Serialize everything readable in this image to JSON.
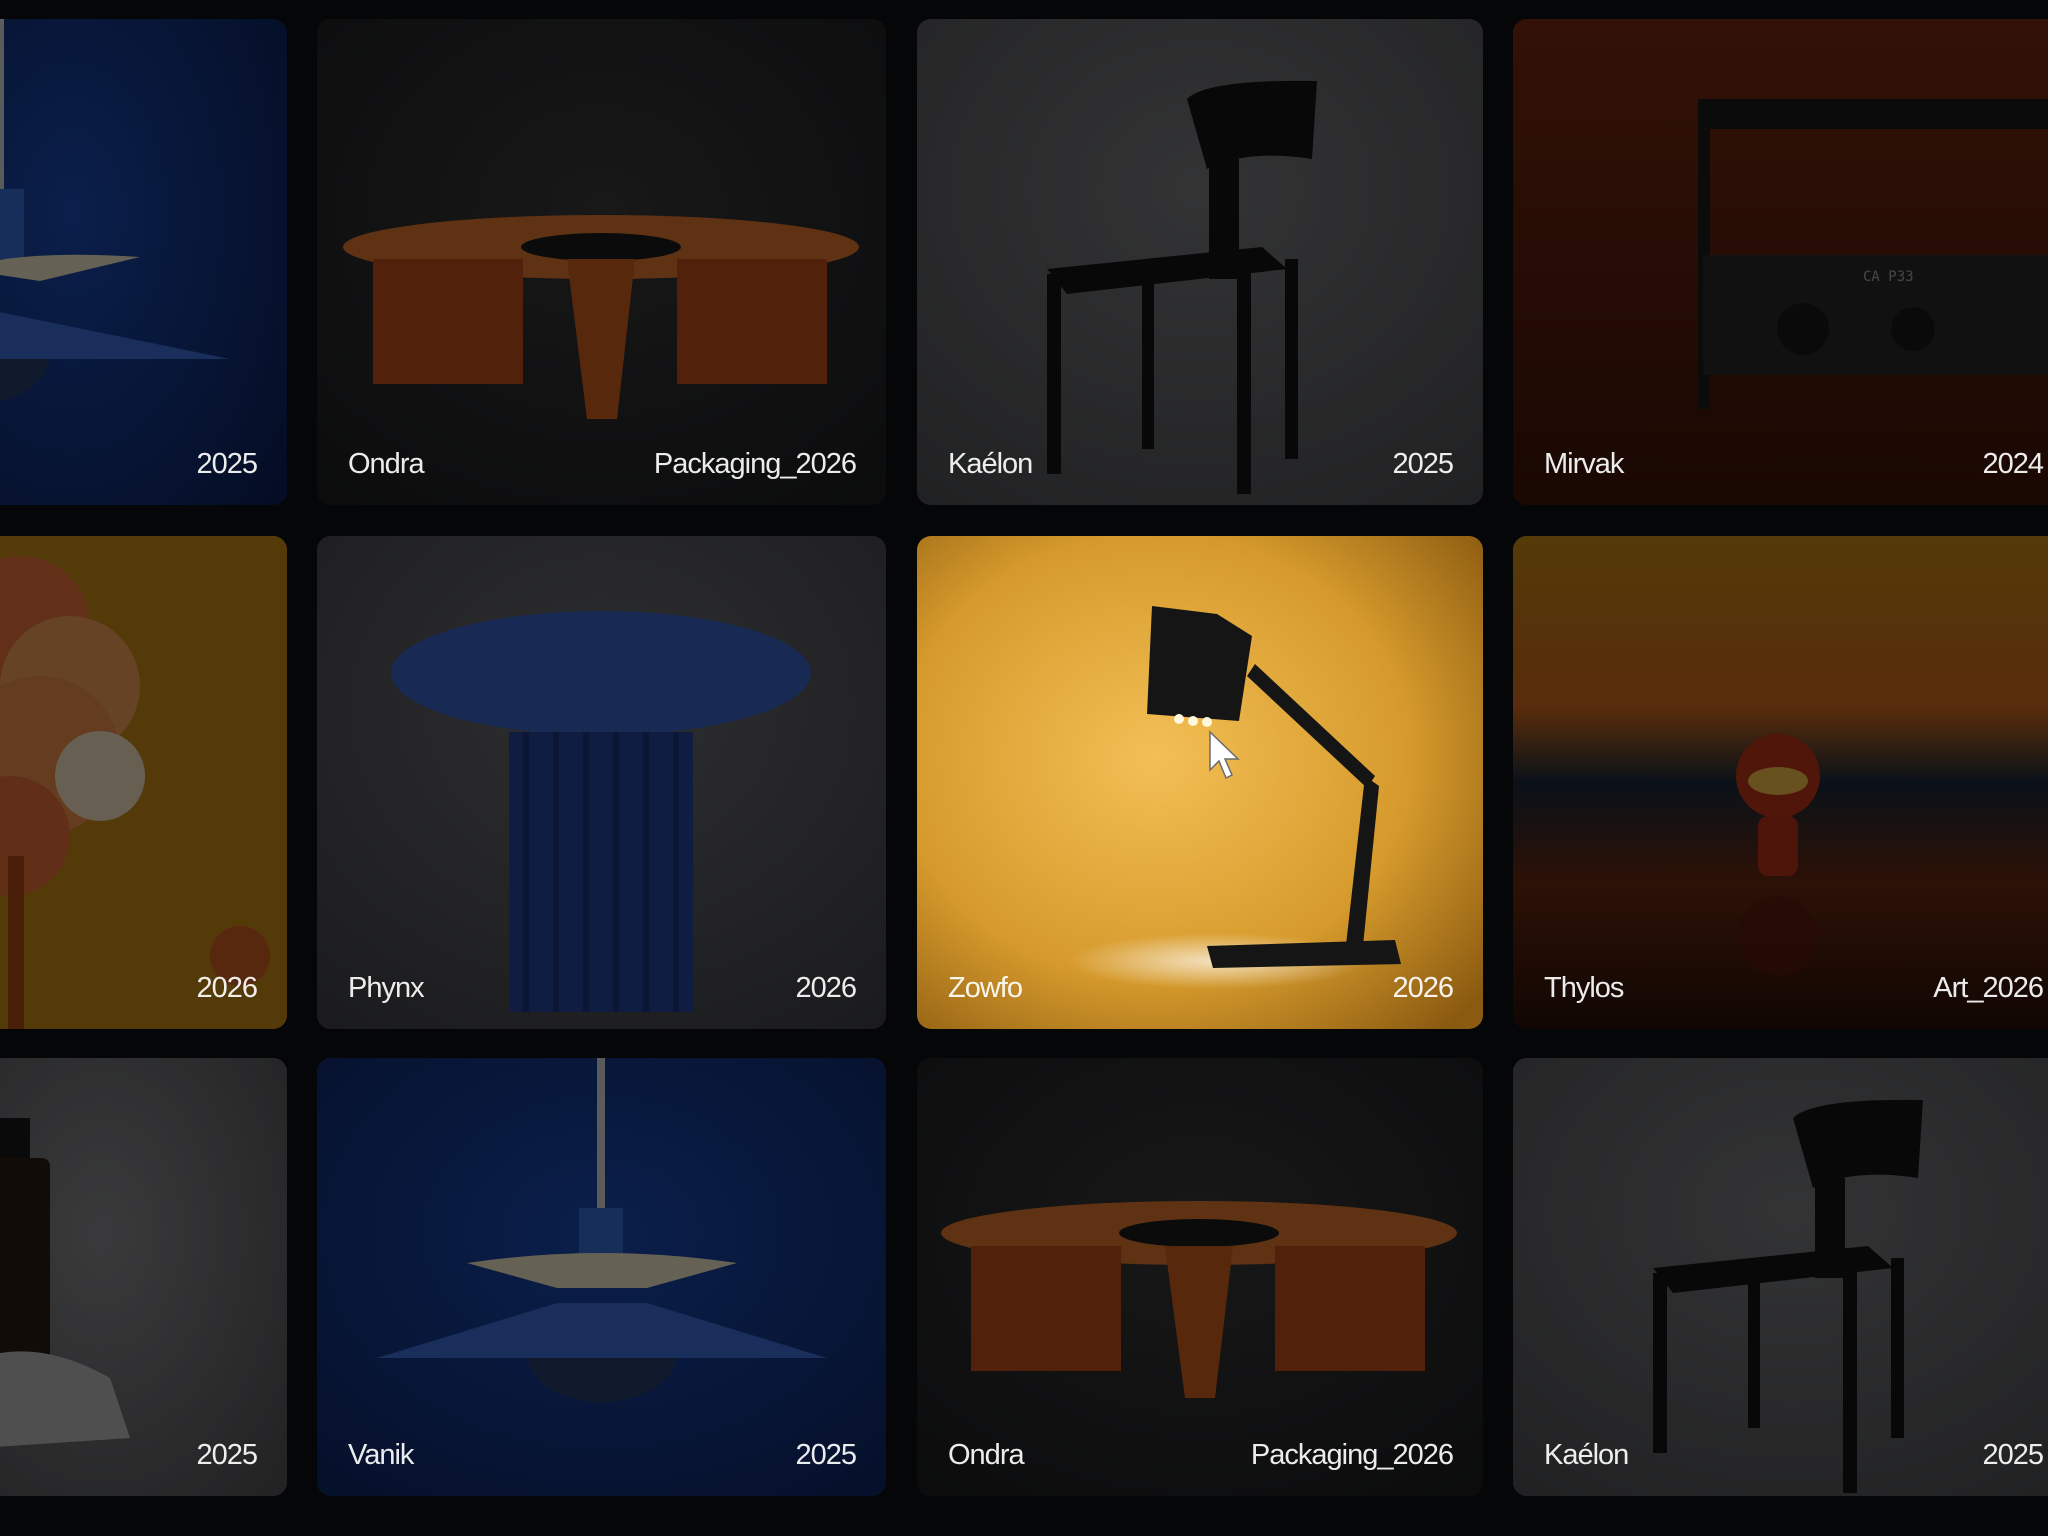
{
  "gallery": {
    "cards": [
      {
        "name": "",
        "tag": "2025"
      },
      {
        "name": "Ondra",
        "tag": "Packaging_2026"
      },
      {
        "name": "Kaélon",
        "tag": "2025"
      },
      {
        "name": "Mirvak",
        "tag": "2024"
      },
      {
        "name": "",
        "tag": "2026"
      },
      {
        "name": "Phynx",
        "tag": "2026"
      },
      {
        "name": "Zowfo",
        "tag": "2026"
      },
      {
        "name": "Thylos",
        "tag": "Art_2026"
      },
      {
        "name": "",
        "tag": "2025"
      },
      {
        "name": "Vanik",
        "tag": "2025"
      },
      {
        "name": "Ondra",
        "tag": "Packaging_2026"
      },
      {
        "name": "Kaélon",
        "tag": "2025"
      }
    ],
    "active_card": "Zowfo"
  },
  "colors": {
    "background": "#050608",
    "card_blue": "#0f2a66",
    "card_dark": "#17181b",
    "card_rust": "#5a1e0c",
    "card_amber": "#c98b14",
    "active_glow": "#f2b53c",
    "label_text": "#ffffff"
  },
  "icons": {
    "cursor": "arrow-pointer-icon"
  }
}
